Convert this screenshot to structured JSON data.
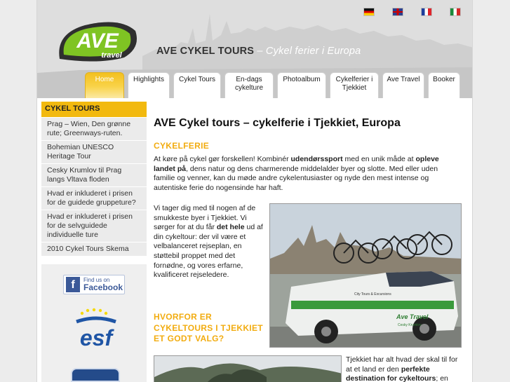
{
  "flags": [
    {
      "lang": "Deutsch",
      "icon": "flag-de-icon"
    },
    {
      "lang": "English",
      "icon": "flag-gb-icon"
    },
    {
      "lang": "Français",
      "icon": "flag-fr-icon"
    },
    {
      "lang": "Italiano",
      "icon": "flag-it-icon"
    }
  ],
  "logo": {
    "main": "AVE",
    "sub": "travel"
  },
  "tagline": {
    "brand": "AVE CYKEL TOURS",
    "sub": " – Cykel ferier i Europa"
  },
  "nav": {
    "home": "Home",
    "highlights": "Highlights",
    "cykel_tours": "Cykel Tours",
    "en_dags_1": "En-dags",
    "en_dags_2": "cykelture",
    "photoalbum": "Photoalbum",
    "cykelferier_1": "Cykelferier i",
    "cykelferier_2": "Tjekkiet",
    "ave_travel": "Ave Travel",
    "booker": "Booker"
  },
  "sidebar": {
    "heading": "CYKEL TOURS",
    "items": [
      "Prag – Wien, Den grønne rute; Greenways-ruten.",
      "Bohemian UNESCO Heritage Tour",
      "Cesky Krumlov til Prag langs Vltava floden",
      "Hvad er inkluderet i prisen for de guidede gruppeture?",
      "Hvad er inkluderet i prisen for de selvguidede individuelle ture",
      "2010 Cykel Tours Skema"
    ],
    "facebook": {
      "top": "Find us on",
      "main": "Facebook"
    },
    "esf_label": "esf"
  },
  "main": {
    "title": "AVE Cykel tours – cykelferie i Tjekkiet, Europa",
    "section1_heading": "CYKELFERIE",
    "p1": {
      "a": "At køre på cykel gør forskellen! Kombinér ",
      "b": "udendørssport",
      "c": " med en unik måde at ",
      "d": "opleve landet på",
      "e": ", dens natur og dens charmerende middelalder byer og slotte. Med eller uden familie og venner, kan du møde andre cykelentusiaster og nyde den mest intense og autentiske ferie do nogensinde har haft."
    },
    "p2": {
      "a": "Vi tager dig med til nogen af de smukkeste byer i Tjekkiet. Vi sørger for at du får ",
      "b": "det hele",
      "c": " ud af din cykeltour: der vil være et velbalanceret rejseplan, en støttebil proppet med det fornødne, og vores erfarne, kvalificeret rejseledere."
    },
    "section2_heading": "HVORFOR ER CYKELTOURS I TJEKKIET ET GODT VALG?",
    "p3": {
      "a": "Tjekkiet har alt hvad der skal til for at et land er den ",
      "b": "perfekte destination for cykeltours",
      "c": "; en"
    },
    "bus_text": {
      "side": "City Tours & Excursions",
      "brand": "Ave Travel",
      "plate": "Cesky Krumlov"
    }
  }
}
